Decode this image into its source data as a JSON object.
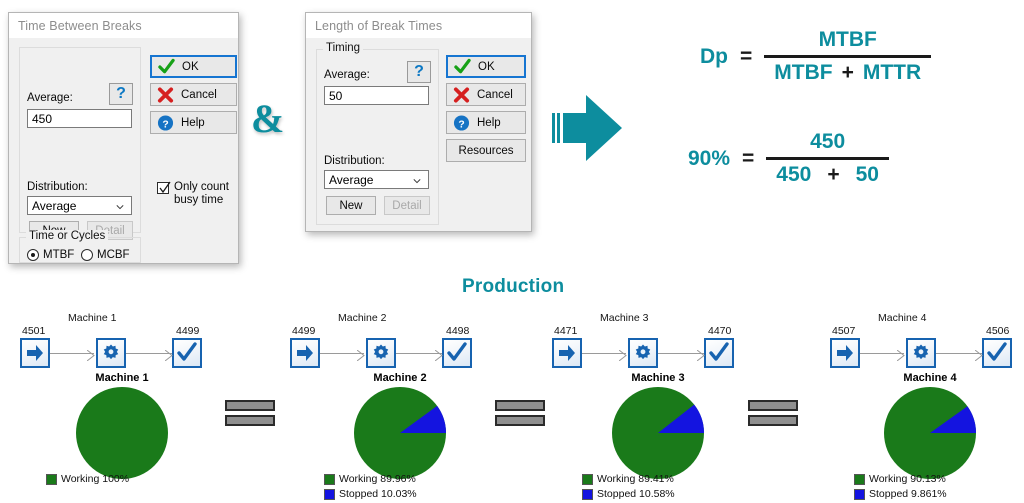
{
  "colors": {
    "teal": "#0d8d9e",
    "working_green": "#1a7a1a",
    "stopped_blue": "#1414e0",
    "node_blue": "#1763b0",
    "accent_default_btn": "#1675d1"
  },
  "dialog1": {
    "title": "Time Between Breaks",
    "average_label": "Average:",
    "average_value": "450",
    "help_icon_glyph": "?",
    "distribution_label": "Distribution:",
    "distribution_value": "Average",
    "new_label": "New",
    "detail_label": "Detail",
    "buttons": {
      "ok": "OK",
      "cancel": "Cancel",
      "help": "Help"
    },
    "checkbox": {
      "label": "Only count busy time",
      "checked": true
    },
    "time_or_cycles": {
      "group_label": "Time or Cycles",
      "options": [
        {
          "label": "MTBF",
          "selected": true
        },
        {
          "label": "MCBF",
          "selected": false
        }
      ]
    }
  },
  "dialog2": {
    "title": "Length of Break Times",
    "timing_group_label": "Timing",
    "average_label": "Average:",
    "average_value": "50",
    "help_icon_glyph": "?",
    "distribution_label": "Distribution:",
    "distribution_value": "Average",
    "new_label": "New",
    "detail_label": "Detail",
    "buttons": {
      "ok": "OK",
      "cancel": "Cancel",
      "help": "Help",
      "resources": "Resources"
    }
  },
  "connector": {
    "ampersand": "&",
    "arrow": "right-arrow"
  },
  "formula": {
    "row1": {
      "left": "Dp",
      "equals": "=",
      "numerator": "MTBF",
      "den_left": "MTBF",
      "den_op": "+",
      "den_right": "MTTR"
    },
    "row2": {
      "left": "90%",
      "equals": "=",
      "numerator": "450",
      "den_left": "450",
      "den_op": "+",
      "den_right": "50"
    }
  },
  "production": {
    "title": "Production",
    "machines": [
      {
        "flow_label": "Machine 1",
        "in_count": "4501",
        "out_count": "4499",
        "pie_title": "Machine 1",
        "legend": [
          {
            "label": "Working 100%",
            "color": "#1a7a1a",
            "value": 100
          }
        ],
        "chart_values": [
          100,
          0
        ]
      },
      {
        "flow_label": "Machine 2",
        "in_count": "4499",
        "out_count": "4498",
        "pie_title": "Machine 2",
        "legend": [
          {
            "label": "Working 89.96%",
            "color": "#1a7a1a",
            "value": 89.96
          },
          {
            "label": "Stopped 10.03%",
            "color": "#1414e0",
            "value": 10.03
          }
        ],
        "chart_values": [
          89.96,
          10.03
        ]
      },
      {
        "flow_label": "Machine 3",
        "in_count": "4471",
        "out_count": "4470",
        "pie_title": "Machine 3",
        "legend": [
          {
            "label": "Working 89.41%",
            "color": "#1a7a1a",
            "value": 89.41
          },
          {
            "label": "Stopped 10.58%",
            "color": "#1414e0",
            "value": 10.58
          }
        ],
        "chart_values": [
          89.41,
          10.58
        ]
      },
      {
        "flow_label": "Machine 4",
        "in_count": "4507",
        "out_count": "4506",
        "pie_title": "Machine 4",
        "legend": [
          {
            "label": "Working 90.13%",
            "color": "#1a7a1a",
            "value": 90.13
          },
          {
            "label": "Stopped 9.861%",
            "color": "#1414e0",
            "value": 9.861
          }
        ],
        "chart_values": [
          90.13,
          9.861
        ]
      }
    ]
  },
  "chart_data": [
    {
      "type": "pie",
      "title": "Machine 1",
      "categories": [
        "Working",
        "Stopped"
      ],
      "values": [
        100,
        0
      ],
      "labels": [
        "Working 100%"
      ],
      "colors": [
        "#1a7a1a",
        "#1414e0"
      ],
      "legend_position": "bottom-left"
    },
    {
      "type": "pie",
      "title": "Machine 2",
      "categories": [
        "Working",
        "Stopped"
      ],
      "values": [
        89.96,
        10.03
      ],
      "labels": [
        "Working 89.96%",
        "Stopped 10.03%"
      ],
      "colors": [
        "#1a7a1a",
        "#1414e0"
      ],
      "legend_position": "bottom-left"
    },
    {
      "type": "pie",
      "title": "Machine 3",
      "categories": [
        "Working",
        "Stopped"
      ],
      "values": [
        89.41,
        10.58
      ],
      "labels": [
        "Working 89.41%",
        "Stopped 10.58%"
      ],
      "colors": [
        "#1a7a1a",
        "#1414e0"
      ],
      "legend_position": "bottom-left"
    },
    {
      "type": "pie",
      "title": "Machine 4",
      "categories": [
        "Working",
        "Stopped"
      ],
      "values": [
        90.13,
        9.861
      ],
      "labels": [
        "Working 90.13%",
        "Stopped 9.861%"
      ],
      "colors": [
        "#1a7a1a",
        "#1414e0"
      ],
      "legend_position": "bottom-left"
    }
  ]
}
